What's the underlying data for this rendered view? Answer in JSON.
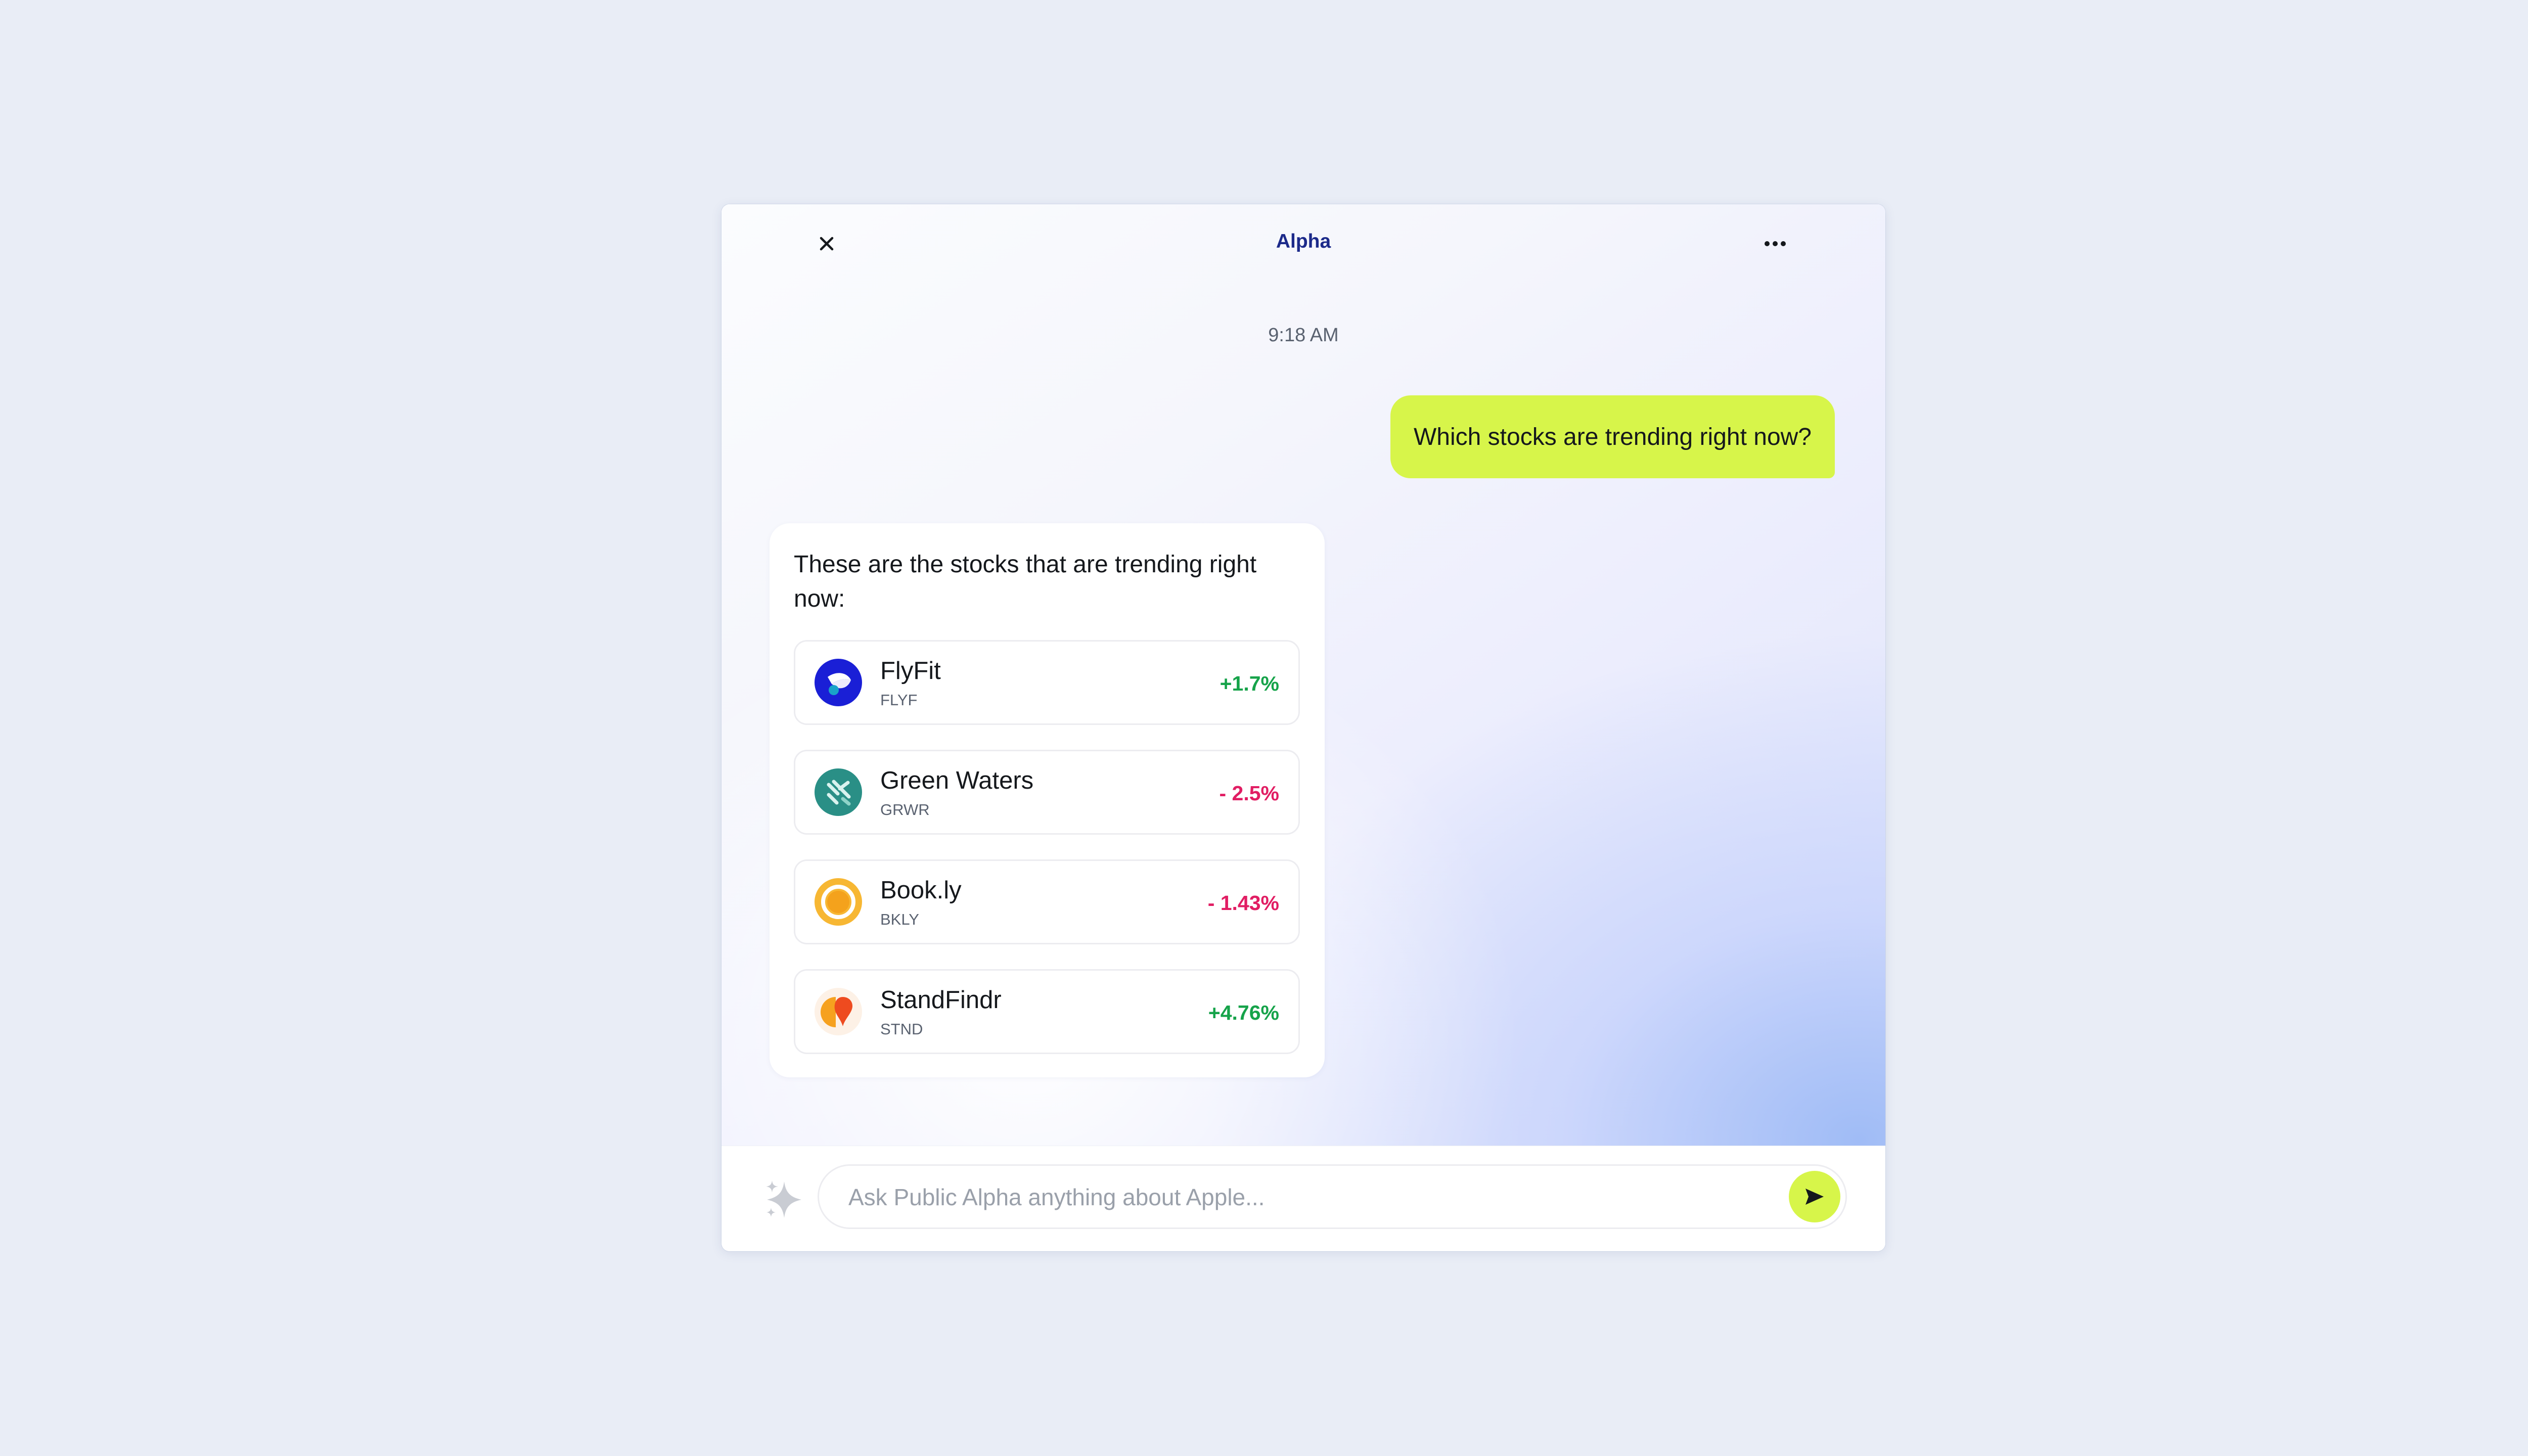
{
  "header": {
    "title": "Alpha",
    "close_icon": "close-icon",
    "more_icon": "more-horizontal-icon"
  },
  "conversation": {
    "timestamp": "9:18 AM",
    "user_message": "Which stocks are trending right now?",
    "assistant_message": "These are the stocks that are trending right now:",
    "stocks": [
      {
        "name": "FlyFit",
        "ticker": "FLYF",
        "change": "+1.7%",
        "direction": "up",
        "logo_icon": "flyfit-logo-icon"
      },
      {
        "name": "Green Waters",
        "ticker": "GRWR",
        "change": "- 2.5%",
        "direction": "down",
        "logo_icon": "green-waters-logo-icon"
      },
      {
        "name": "Book.ly",
        "ticker": "BKLY",
        "change": "- 1.43%",
        "direction": "down",
        "logo_icon": "bookly-logo-icon"
      },
      {
        "name": "StandFindr",
        "ticker": "STND",
        "change": "+4.76%",
        "direction": "up",
        "logo_icon": "standfindr-logo-icon"
      }
    ]
  },
  "composer": {
    "placeholder": "Ask Public Alpha anything about Apple...",
    "value": "",
    "ai_icon": "sparkle-icon",
    "send_icon": "send-arrow-icon"
  },
  "colors": {
    "accent": "#d7f54a",
    "title": "#1c2a8a",
    "positive": "#16a34a",
    "negative": "#e11d63",
    "background": "#e9edf6"
  }
}
